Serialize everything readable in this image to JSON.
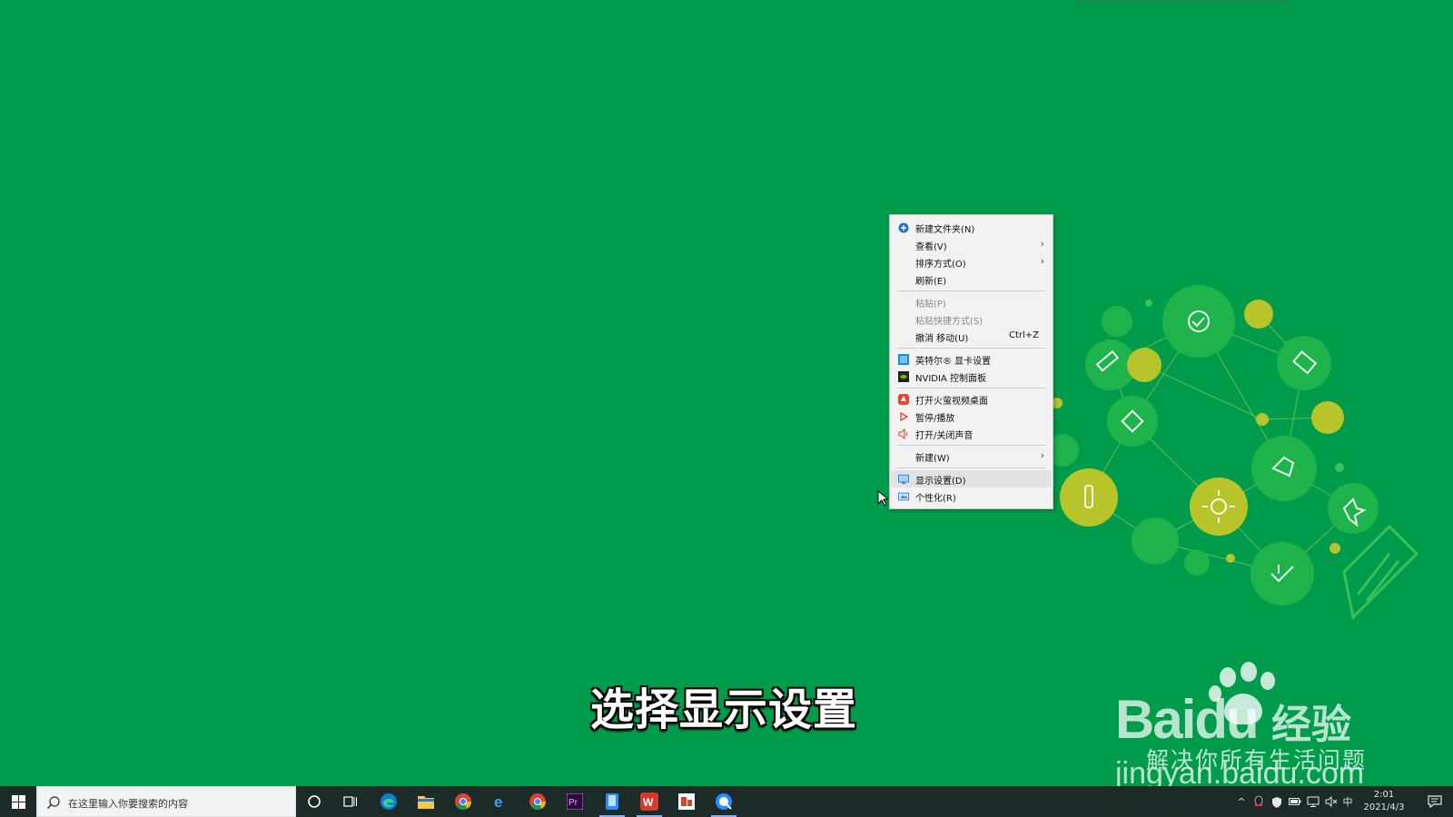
{
  "menu": {
    "items": [
      {
        "label": "新建文件夹(N)",
        "icon": "new-folder-icon"
      },
      {
        "label": "查看(V)",
        "has_submenu": true
      },
      {
        "label": "排序方式(O)",
        "has_submenu": true
      },
      {
        "label": "刷新(E)"
      },
      {
        "label": "粘贴(P)",
        "disabled": true
      },
      {
        "label": "粘贴快捷方式(S)",
        "disabled": true
      },
      {
        "label": "撤消 移动(U)",
        "shortcut": "Ctrl+Z"
      },
      {
        "label": "英特尔® 显卡设置",
        "icon": "intel-graphics-icon"
      },
      {
        "label": "NVIDIA 控制面板",
        "icon": "nvidia-icon"
      },
      {
        "label": "打开火萤视频桌面",
        "icon": "huoying-icon"
      },
      {
        "label": "暂停/播放",
        "icon": "play-icon"
      },
      {
        "label": "打开/关闭声音",
        "icon": "speaker-icon"
      },
      {
        "label": "新建(W)",
        "has_submenu": true
      },
      {
        "label": "显示设置(D)",
        "icon": "display-icon",
        "hover": true
      },
      {
        "label": "个性化(R)",
        "icon": "personalize-icon"
      }
    ]
  },
  "subtitle": "选择显示设置",
  "watermark": {
    "logo_text": "Baidu",
    "product": "经验",
    "tagline": "解决你所有生活问题",
    "url": "jingyan.baidu.com"
  },
  "taskbar": {
    "search_placeholder": "在这里输入你要搜索的内容",
    "apps": [
      "cortana-icon",
      "task-view-icon",
      "edge-icon",
      "file-explorer-icon",
      "chrome-icon",
      "ie-icon",
      "chrome-icon",
      "premiere-icon",
      "phone-app-icon",
      "wps-icon",
      "powerpoint-icon",
      "browser-icon"
    ],
    "ime": "中",
    "time": "2:01",
    "date": "2021/4/3"
  },
  "colors": {
    "desktop_bg": "#009b4b",
    "taskbar_bg": "#1c2a28",
    "menu_bg": "#f2f2f2"
  }
}
